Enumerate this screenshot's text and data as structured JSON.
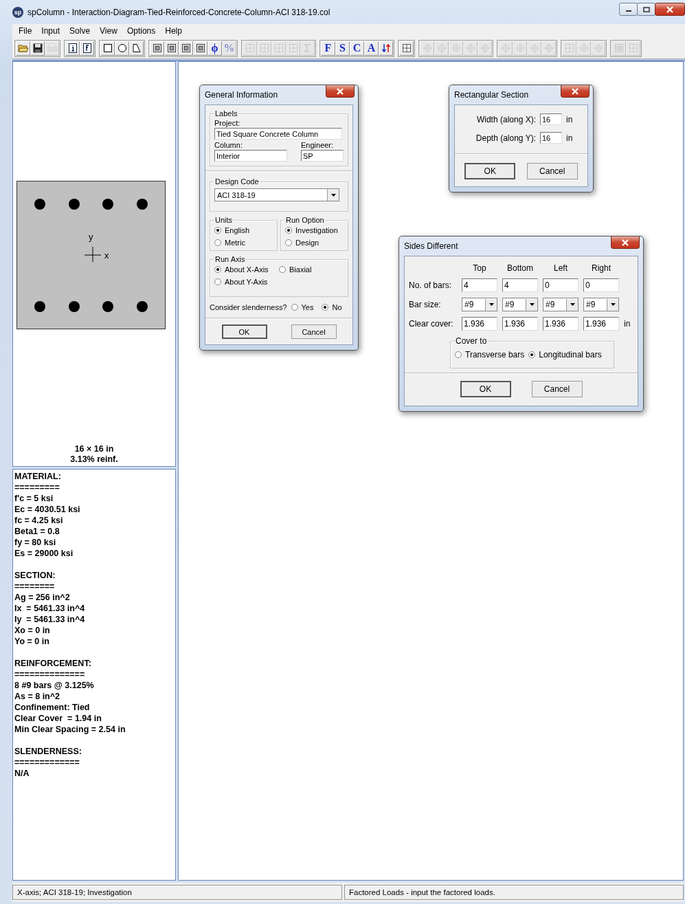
{
  "window": {
    "logo": "sp",
    "title": "spColumn - Interaction-Diagram-Tied-Reinforced-Concrete-Column-ACI 318-19.col"
  },
  "menu": [
    "File",
    "Input",
    "Solve",
    "View",
    "Options",
    "Help"
  ],
  "toolbar": [
    [
      {
        "kind": "open",
        "disabled": false
      },
      {
        "kind": "save",
        "disabled": false
      },
      {
        "kind": "print",
        "disabled": true
      }
    ],
    [
      {
        "kind": "info",
        "disabled": false
      },
      {
        "kind": "fc",
        "disabled": false
      }
    ],
    [
      {
        "kind": "square",
        "disabled": false
      },
      {
        "kind": "circle",
        "disabled": false
      },
      {
        "kind": "polygon",
        "disabled": false
      }
    ],
    [
      {
        "kind": "frame",
        "disabled": false
      },
      {
        "kind": "frame",
        "disabled": false
      },
      {
        "kind": "frame",
        "disabled": false
      },
      {
        "kind": "frame",
        "disabled": false
      },
      {
        "kind": "letter",
        "text": "ϕ",
        "disabled": false
      },
      {
        "kind": "letter",
        "text": "%",
        "disabled": true
      }
    ],
    [
      {
        "kind": "grid",
        "disabled": true
      },
      {
        "kind": "grid",
        "disabled": true
      },
      {
        "kind": "grid",
        "disabled": true
      },
      {
        "kind": "grid",
        "disabled": true
      },
      {
        "kind": "sigma",
        "disabled": true
      }
    ],
    [
      {
        "kind": "letter",
        "text": "F",
        "disabled": false
      },
      {
        "kind": "letter",
        "text": "S",
        "disabled": false
      },
      {
        "kind": "letter",
        "text": "C",
        "disabled": false
      },
      {
        "kind": "letter",
        "text": "A",
        "disabled": false
      },
      {
        "kind": "arrows",
        "disabled": false
      }
    ],
    [
      {
        "kind": "grid",
        "disabled": false
      }
    ],
    [
      {
        "kind": "diagram",
        "disabled": true
      },
      {
        "kind": "diagram",
        "disabled": true
      },
      {
        "kind": "diagram",
        "disabled": true
      },
      {
        "kind": "diagram",
        "disabled": true
      },
      {
        "kind": "diagram",
        "disabled": true
      }
    ],
    [
      {
        "kind": "diagram",
        "disabled": true
      },
      {
        "kind": "diagram",
        "disabled": true
      },
      {
        "kind": "diagram",
        "disabled": true
      },
      {
        "kind": "diagram",
        "disabled": true
      }
    ],
    [
      {
        "kind": "grid",
        "disabled": true
      },
      {
        "kind": "diagram",
        "disabled": true
      },
      {
        "kind": "diagram",
        "disabled": true
      }
    ],
    [
      {
        "kind": "frame",
        "disabled": true
      },
      {
        "kind": "grid",
        "disabled": true
      }
    ]
  ],
  "section_view": {
    "axis_y": "y",
    "axis_x": "x",
    "caption": [
      "16 × 16 in",
      "3.13% reinf."
    ]
  },
  "properties": [
    {
      "heading": "MATERIAL:",
      "rule": "=========",
      "lines": [
        "f'c = 5 ksi",
        "Ec = 4030.51 ksi",
        "fc = 4.25 ksi",
        "Beta1 = 0.8",
        "fy = 80 ksi",
        "Es = 29000 ksi"
      ]
    },
    {
      "heading": "SECTION:",
      "rule": "========",
      "lines": [
        "Ag = 256 in^2",
        "Ix  = 5461.33 in^4",
        "Iy  = 5461.33 in^4",
        "Xo = 0 in",
        "Yo = 0 in"
      ]
    },
    {
      "heading": "REINFORCEMENT:",
      "rule": "==============",
      "lines": [
        "8 #9 bars @ 3.125%",
        "As = 8 in^2",
        "Confinement: Tied",
        "Clear Cover  = 1.94 in",
        "Min Clear Spacing = 2.54 in"
      ]
    },
    {
      "heading": "SLENDERNESS:",
      "rule": "=============",
      "lines": [
        "N/A"
      ]
    }
  ],
  "general_information": {
    "title": "General Information",
    "labels": {
      "legend": "Labels",
      "project_label": "Project:",
      "project": "Tied Square Concrete Column",
      "column_label": "Column:",
      "column": "Interior",
      "engineer_label": "Engineer:",
      "engineer": "SP"
    },
    "design_code": {
      "legend": "Design Code",
      "value": "ACI 318-19"
    },
    "units": {
      "legend": "Units",
      "options": [
        {
          "label": "English",
          "selected": true
        },
        {
          "label": "Metric",
          "selected": false
        }
      ]
    },
    "run_option": {
      "legend": "Run Option",
      "options": [
        {
          "label": "Investigation",
          "selected": true
        },
        {
          "label": "Design",
          "selected": false
        }
      ]
    },
    "run_axis": {
      "legend": "Run Axis",
      "options": [
        {
          "label": "About X-Axis",
          "selected": true
        },
        {
          "label": "Biaxial",
          "selected": false
        },
        {
          "label": "About Y-Axis",
          "selected": false
        }
      ]
    },
    "slenderness": {
      "label": "Consider slenderness?",
      "options": [
        {
          "label": "Yes",
          "selected": false
        },
        {
          "label": "No",
          "selected": true
        }
      ]
    },
    "buttons": [
      "OK",
      "Cancel"
    ]
  },
  "rectangular_section": {
    "title": "Rectangular Section",
    "fields": [
      {
        "label": "Width (along X):",
        "value": "16",
        "unit": "in"
      },
      {
        "label": "Depth (along Y):",
        "value": "16",
        "unit": "in"
      }
    ],
    "buttons": [
      "OK",
      "Cancel"
    ]
  },
  "sides_different": {
    "title": "Sides Different",
    "columns": [
      "Top",
      "Bottom",
      "Left",
      "Right"
    ],
    "rows": [
      {
        "kind": "text",
        "label": "No. of bars:",
        "values": [
          "4",
          "4",
          "0",
          "0"
        ]
      },
      {
        "kind": "select",
        "label": "Bar size:",
        "values": [
          "#9",
          "#9",
          "#9",
          "#9"
        ]
      },
      {
        "kind": "text",
        "label": "Clear cover:",
        "values": [
          "1.936",
          "1.936",
          "1.936",
          "1.936"
        ],
        "unit": "in"
      }
    ],
    "cover_to": {
      "legend": "Cover to",
      "options": [
        {
          "label": "Transverse bars",
          "selected": false
        },
        {
          "label": "Longitudinal bars",
          "selected": true
        }
      ]
    },
    "buttons": [
      "OK",
      "Cancel"
    ]
  },
  "status_bar": [
    "X-axis; ACI 318-19; Investigation",
    "Factored Loads - input the factored loads."
  ]
}
